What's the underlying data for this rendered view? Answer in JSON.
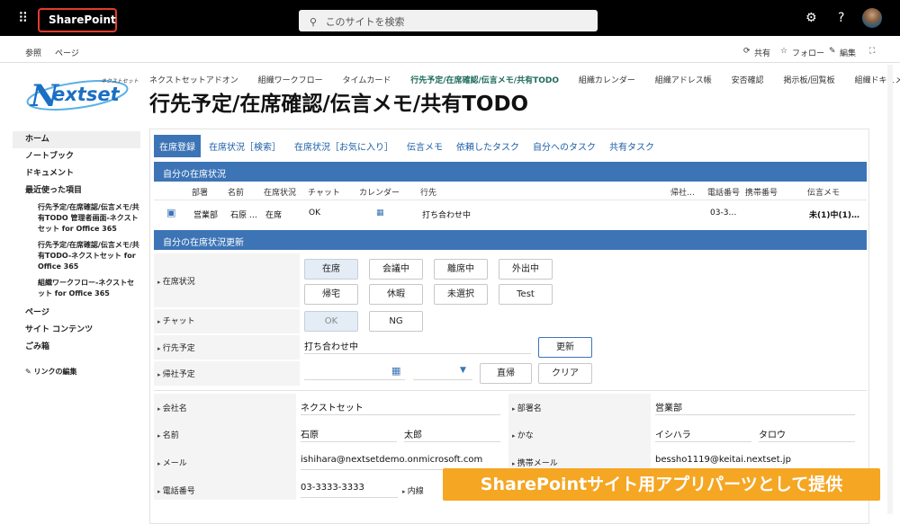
{
  "suite_bar": {
    "app_name": "SharePoint",
    "search_placeholder": "このサイトを検索"
  },
  "command_bar": {
    "left": [
      "参照",
      "ページ"
    ],
    "share": "共有",
    "follow": "フォロー",
    "edit": "編集"
  },
  "logo": {
    "tagline": "ネクストセット",
    "brand": "Nextset"
  },
  "hub_nav": [
    "ネクストセットアドオン",
    "組織ワークフロー",
    "タイムカード",
    "行先予定/在席確認/伝言メモ/共有TODO",
    "組織カレンダー",
    "組織アドレス帳",
    "安否確認",
    "掲示板/回覧板",
    "組織ドキュメント管"
  ],
  "page_title": "行先予定/在席確認/伝言メモ/共有TODO",
  "left_nav": {
    "home": "ホーム",
    "notebook": "ノートブック",
    "documents": "ドキュメント",
    "recent": "最近使った項目",
    "recent_items": [
      "行先予定/在席確認/伝言メモ/共有TODO 管理者画面-ネクストセット for Office 365",
      "行先予定/在席確認/伝言メモ/共有TODO-ネクストセット for Office 365",
      "組織ワークフロー-ネクストセット for Office 365"
    ],
    "pages": "ページ",
    "site_contents": "サイト コンテンツ",
    "recycle_bin": "ごみ箱",
    "edit_links": "リンクの編集"
  },
  "tabs": [
    "在席登録",
    "在席状況［検索］",
    "在席状況［お気に入り］",
    "伝言メモ",
    "依頼したタスク",
    "自分へのタスク",
    "共有タスク"
  ],
  "my_status": {
    "title": "自分の在席状況",
    "headers": [
      "部署",
      "名前",
      "在席状況",
      "チャット",
      "カレンダー",
      "行先",
      "帰社…",
      "電話番号",
      "携帯番号",
      "伝言メモ"
    ],
    "row": {
      "dept": "営業部",
      "name": "石原 …",
      "status": "在席",
      "chat": "OK",
      "destination": "打ち合わせ中",
      "return": "",
      "phone": "03-3…",
      "mobile": "",
      "memo": "未(1)中(1)…"
    }
  },
  "update": {
    "title": "自分の在席状況更新",
    "status_label": "在席状況",
    "status_options": [
      "在席",
      "会議中",
      "離席中",
      "外出中",
      "帰宅",
      "休暇",
      "未選択",
      "Test"
    ],
    "chat_label": "チャット",
    "chat_options": [
      "OK",
      "NG"
    ],
    "destination_label": "行先予定",
    "destination_value": "打ち合わせ中",
    "update_button": "更新",
    "return_label": "帰社予定",
    "direct_home_button": "直帰",
    "clear_button": "クリア"
  },
  "profile": {
    "company_label": "会社名",
    "company": "ネクストセット",
    "dept_label": "部署名",
    "dept": "営業部",
    "name_label": "名前",
    "last_name": "石原",
    "first_name": "太郎",
    "kana_label": "かな",
    "last_kana": "イシハラ",
    "first_kana": "タロウ",
    "mail_label": "メール",
    "mail": "ishihara@nextsetdemo.onmicrosoft.com",
    "mobile_mail_label": "携帯メール",
    "mobile_mail": "bessho1119@keitai.nextset.jp",
    "phone_label": "電話番号",
    "phone": "03-3333-3333",
    "extension_label": "内線"
  },
  "banner": "SharePointサイト用アプリパーツとして提供",
  "colors": {
    "accent": "#3c74b6",
    "banner": "#f5a623",
    "highlight": "#e53b2a"
  }
}
